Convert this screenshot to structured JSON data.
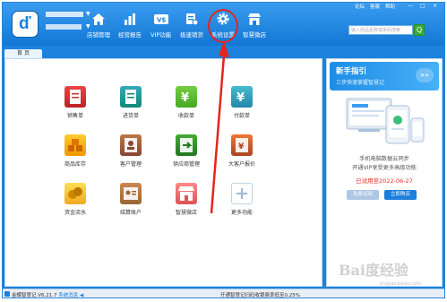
{
  "header": {
    "user_name_label": "店铺",
    "top_links": [
      "论坛",
      "客服",
      "帮助"
    ],
    "window_controls": [
      "—",
      "□",
      "×"
    ]
  },
  "nav": [
    {
      "label": "店铺管理",
      "icon": "home-icon"
    },
    {
      "label": "经营报告",
      "icon": "bar-chart-icon"
    },
    {
      "label": "VIP功能",
      "icon": "vip-card-icon"
    },
    {
      "label": "极速销货",
      "icon": "fast-sale-icon"
    },
    {
      "label": "系统设置",
      "icon": "gear-icon"
    },
    {
      "label": "智慧微店",
      "icon": "store-icon"
    }
  ],
  "search": {
    "placeholder": "输入商品名称或条码搜索",
    "button": "Q"
  },
  "tabs": {
    "home": "首 页"
  },
  "tiles": [
    {
      "label": "销售单",
      "icon": "sales-order-icon"
    },
    {
      "label": "进货单",
      "icon": "purchase-order-icon"
    },
    {
      "label": "收款单",
      "icon": "receipt-icon"
    },
    {
      "label": "付款单",
      "icon": "payment-icon"
    },
    {
      "label": "商品库存",
      "icon": "inventory-icon"
    },
    {
      "label": "客户管理",
      "icon": "customer-icon"
    },
    {
      "label": "供应商管理",
      "icon": "supplier-icon"
    },
    {
      "label": "大客户报价",
      "icon": "quote-icon"
    },
    {
      "label": "资金流水",
      "icon": "cash-flow-icon"
    },
    {
      "label": "结算账户",
      "icon": "account-icon"
    },
    {
      "label": "智慧微店",
      "icon": "micro-store-icon"
    },
    {
      "label": "更多功能",
      "icon": "plus-icon"
    }
  ],
  "side": {
    "guide_title": "新手指引",
    "guide_sub": "三步快速掌握智慧记",
    "guide_arrows": "»»",
    "line1": "手机电脑数据云同步",
    "line2": "开通VIP享受更多高级功能",
    "trial_text": "已试用至2022-06-27",
    "btn_trial": "免费试用",
    "btn_buy": "立即购买"
  },
  "status": {
    "version": "金蝶智慧记 V6.21.7",
    "msg_link": "系统消息",
    "right": "开通智慧记扫码收银费率低至0.25%"
  },
  "watermark": {
    "main": "Bai度经验",
    "sub": "jingyan.baidu.com"
  },
  "colors": {
    "header_blue": "#1c82de",
    "highlight_red": "#e3261c",
    "buy_blue": "#1b7fdb",
    "trial_red": "#e5332a"
  }
}
